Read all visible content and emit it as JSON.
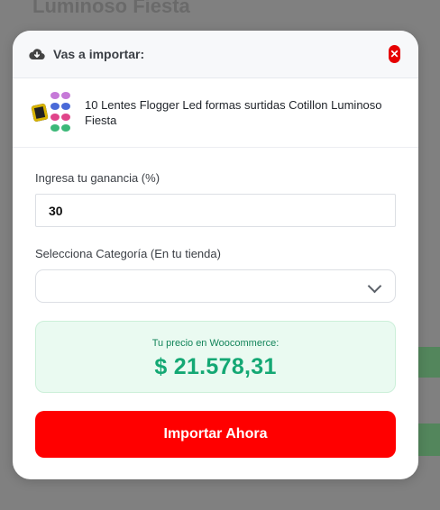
{
  "background": {
    "page_title": "Luminoso Fiesta"
  },
  "modal": {
    "header_title": "Vas a importar:",
    "close_symbol": "✕",
    "product": {
      "title": "10 Lentes Flogger Led formas surtidas Cotillon Luminoso Fiesta"
    },
    "profit": {
      "label": "Ingresa tu ganancia (%)",
      "value": "30"
    },
    "category": {
      "label": "Selecciona Categoría (En tu tienda)",
      "selected": ""
    },
    "price": {
      "label": "Tu precio en Woocommerce:",
      "value": "$ 21.578,31"
    },
    "import_button": "Importar Ahora"
  },
  "colors": {
    "accent_red": "#ff0000",
    "price_green": "#14a874",
    "price_bg": "#eafaf1"
  }
}
